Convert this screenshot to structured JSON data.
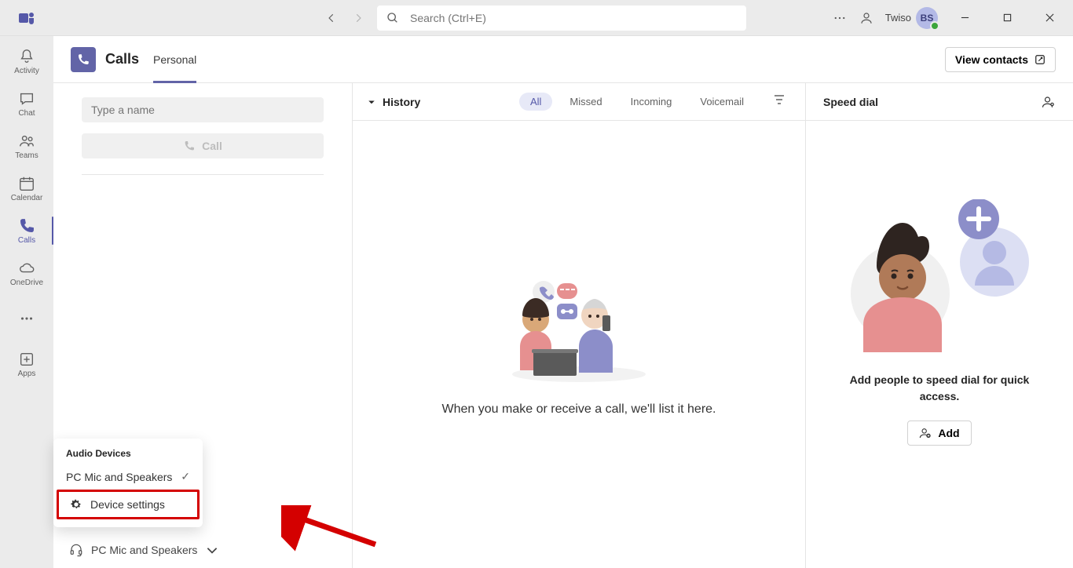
{
  "titlebar": {
    "search_placeholder": "Search (Ctrl+E)",
    "user_name": "Twiso",
    "avatar_initials": "BS"
  },
  "rail": {
    "items": [
      {
        "label": "Activity"
      },
      {
        "label": "Chat"
      },
      {
        "label": "Teams"
      },
      {
        "label": "Calendar"
      },
      {
        "label": "Calls"
      },
      {
        "label": "OneDrive"
      }
    ],
    "apps_label": "Apps"
  },
  "page": {
    "title": "Calls",
    "tab": "Personal",
    "view_contacts": "View contacts"
  },
  "left": {
    "name_placeholder": "Type a name",
    "call_label": "Call"
  },
  "popup": {
    "title": "Audio Devices",
    "selected_device": "PC Mic and Speakers",
    "device_settings": "Device settings"
  },
  "device_row": {
    "label": "PC Mic and Speakers"
  },
  "history": {
    "title": "History",
    "filters": {
      "all": "All",
      "missed": "Missed",
      "incoming": "Incoming",
      "voicemail": "Voicemail"
    },
    "empty_message": "When you make or receive a call, we'll list it here."
  },
  "speeddial": {
    "title": "Speed dial",
    "message": "Add people to speed dial for quick access.",
    "add_label": "Add"
  }
}
